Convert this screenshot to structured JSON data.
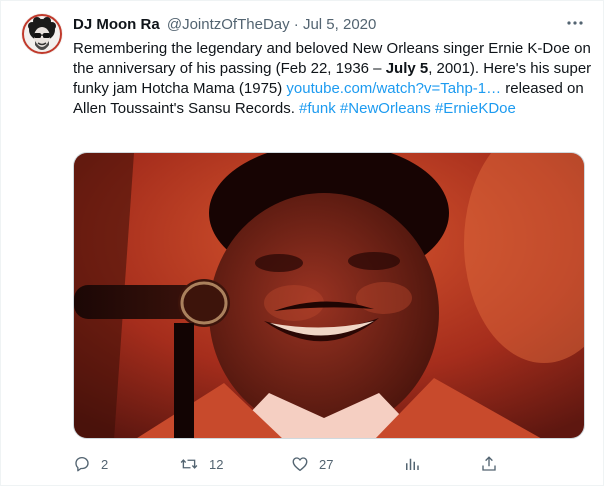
{
  "tweet": {
    "author": {
      "display_name": "DJ Moon Ra",
      "handle": "@JointzOfTheDay"
    },
    "separator": "·",
    "date": "Jul 5, 2020",
    "text": {
      "part1": "Remembering the legendary and beloved New Orleans singer Ernie K-Doe on the anniversary of his passing (Feb 22, 1936 – ",
      "bold": "July 5",
      "part2": ", 2001). Here's his super funky jam Hotcha Mama (1975) ",
      "link": "youtube.com/watch?v=Tahp-1…",
      "part3": " released on Allen Toussaint's Sansu Records. ",
      "hashtags": [
        "#funk",
        "#NewOrleans",
        "#ErnieKDoe"
      ]
    },
    "stats": {
      "replies": "2",
      "retweets": "12",
      "likes": "27"
    }
  },
  "icons": {
    "more": "more-horizontal-icon",
    "reply": "reply-icon",
    "retweet": "retweet-icon",
    "like": "heart-icon",
    "views": "analytics-icon",
    "share": "share-icon"
  },
  "colors": {
    "link": "#1d9bf0",
    "secondary_text": "#536471",
    "primary_text": "#0f1419"
  }
}
